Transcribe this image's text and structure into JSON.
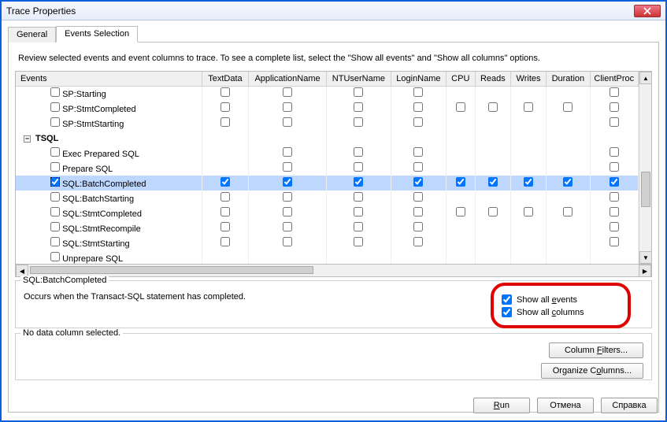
{
  "window": {
    "title": "Trace Properties"
  },
  "tabs": {
    "general": "General",
    "events": "Events Selection"
  },
  "instruction": "Review selected events and event columns to trace. To see a complete list, select the \"Show all events\" and \"Show all columns\" options.",
  "columns": {
    "events": "Events",
    "textdata": "TextData",
    "appname": "ApplicationName",
    "ntuser": "NTUserName",
    "loginname": "LoginName",
    "cpu": "CPU",
    "reads": "Reads",
    "writes": "Writes",
    "duration": "Duration",
    "clientproc": "ClientProc"
  },
  "rows": [
    {
      "id": "sp-starting",
      "label": "SP:Starting",
      "checked": false,
      "cells": {
        "textdata": false,
        "appname": false,
        "ntuser": false,
        "loginname": false,
        "cpu": null,
        "reads": null,
        "writes": null,
        "duration": null,
        "clientproc": false
      }
    },
    {
      "id": "sp-stmtcompleted",
      "label": "SP:StmtCompleted",
      "checked": false,
      "cells": {
        "textdata": false,
        "appname": false,
        "ntuser": false,
        "loginname": false,
        "cpu": false,
        "reads": false,
        "writes": false,
        "duration": false,
        "clientproc": false
      }
    },
    {
      "id": "sp-stmtstarting",
      "label": "SP:StmtStarting",
      "checked": false,
      "cells": {
        "textdata": false,
        "appname": false,
        "ntuser": false,
        "loginname": false,
        "cpu": null,
        "reads": null,
        "writes": null,
        "duration": null,
        "clientproc": false
      }
    },
    {
      "id": "tsql",
      "label": "TSQL",
      "category": true
    },
    {
      "id": "exec-prepared-sql",
      "label": "Exec Prepared SQL",
      "checked": false,
      "cells": {
        "textdata": null,
        "appname": false,
        "ntuser": false,
        "loginname": false,
        "cpu": null,
        "reads": null,
        "writes": null,
        "duration": null,
        "clientproc": false
      }
    },
    {
      "id": "prepare-sql",
      "label": "Prepare SQL",
      "checked": false,
      "cells": {
        "textdata": null,
        "appname": false,
        "ntuser": false,
        "loginname": false,
        "cpu": null,
        "reads": null,
        "writes": null,
        "duration": null,
        "clientproc": false
      }
    },
    {
      "id": "sql-batchcompleted",
      "label": "SQL:BatchCompleted",
      "checked": true,
      "selected": true,
      "cells": {
        "textdata": true,
        "appname": true,
        "ntuser": true,
        "loginname": true,
        "cpu": true,
        "reads": true,
        "writes": true,
        "duration": true,
        "clientproc": true
      }
    },
    {
      "id": "sql-batchstarting",
      "label": "SQL:BatchStarting",
      "checked": false,
      "cells": {
        "textdata": false,
        "appname": false,
        "ntuser": false,
        "loginname": false,
        "cpu": null,
        "reads": null,
        "writes": null,
        "duration": null,
        "clientproc": false
      }
    },
    {
      "id": "sql-stmtcompleted",
      "label": "SQL:StmtCompleted",
      "checked": false,
      "cells": {
        "textdata": false,
        "appname": false,
        "ntuser": false,
        "loginname": false,
        "cpu": false,
        "reads": false,
        "writes": false,
        "duration": false,
        "clientproc": false
      }
    },
    {
      "id": "sql-stmtrecompile",
      "label": "SQL:StmtRecompile",
      "checked": false,
      "cells": {
        "textdata": false,
        "appname": false,
        "ntuser": false,
        "loginname": false,
        "cpu": null,
        "reads": null,
        "writes": null,
        "duration": null,
        "clientproc": false
      }
    },
    {
      "id": "sql-stmtstarting",
      "label": "SQL:StmtStarting",
      "checked": false,
      "cells": {
        "textdata": false,
        "appname": false,
        "ntuser": false,
        "loginname": false,
        "cpu": null,
        "reads": null,
        "writes": null,
        "duration": null,
        "clientproc": false
      }
    },
    {
      "id": "unprepare-sql",
      "label": "Unprepare SQL",
      "checked": false,
      "cells": {}
    }
  ],
  "description": {
    "title": "SQL:BatchCompleted",
    "text": "Occurs when the Transact-SQL statement has completed."
  },
  "options": {
    "show_all_events": {
      "prefix": "Show all ",
      "u": "e",
      "suffix": "vents",
      "checked": true
    },
    "show_all_columns": {
      "prefix": "Show all ",
      "u": "c",
      "suffix": "olumns",
      "checked": true
    }
  },
  "nodata": "No data column selected.",
  "buttons": {
    "column_filters": {
      "prefix": "Column ",
      "u": "F",
      "suffix": "ilters..."
    },
    "organize_columns": {
      "prefix": "Organize C",
      "u": "o",
      "suffix": "lumns..."
    },
    "run": {
      "u": "R",
      "suffix": "un"
    },
    "cancel": "Отмена",
    "help": "Справка"
  }
}
